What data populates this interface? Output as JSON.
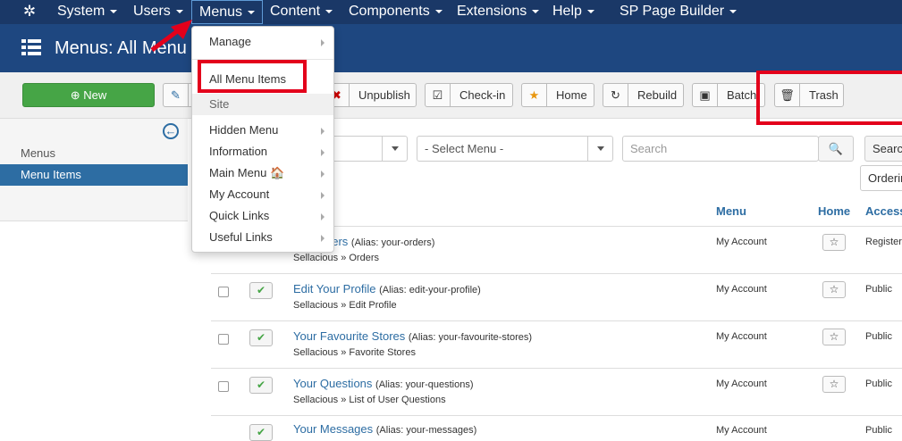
{
  "nav": {
    "items": [
      "System",
      "Users",
      "Menus",
      "Content",
      "Components",
      "Extensions",
      "Help",
      "SP Page Builder"
    ]
  },
  "header": {
    "title": "Menus: All Menu Items"
  },
  "toolbar": {
    "new": "New",
    "unpublish": "Unpublish",
    "checkin": "Check-in",
    "home": "Home",
    "rebuild": "Rebuild",
    "batch": "Batch",
    "trash": "Trash"
  },
  "sidebar": {
    "items": [
      "Menus",
      "Menu Items"
    ]
  },
  "filters": {
    "select_menu": "- Select Menu -",
    "search_placeholder": "Search",
    "search_button": "Search",
    "ordering": "Ordering"
  },
  "table": {
    "headers": {
      "menu": "Menu",
      "home": "Home",
      "access": "Access"
    },
    "rows": [
      {
        "title": "Your Orders",
        "title_visible": "ders",
        "alias": "(Alias: your-orders)",
        "path": "Sellacious » Orders",
        "menu": "My Account",
        "access": "Registered"
      },
      {
        "title": "Edit Your Profile",
        "alias": "(Alias: edit-your-profile)",
        "path": "Sellacious » Edit Profile",
        "menu": "My Account",
        "access": "Public"
      },
      {
        "title": "Your Favourite Stores",
        "alias": "(Alias: your-favourite-stores)",
        "path": "Sellacious » Favorite Stores",
        "menu": "My Account",
        "access": "Public"
      },
      {
        "title": "Your Questions",
        "alias": "(Alias: your-questions)",
        "path": "Sellacious » List of User Questions",
        "menu": "My Account",
        "access": "Public"
      },
      {
        "title": "Your Messages",
        "alias": "(Alias: your-messages)",
        "path": "",
        "menu": "My Account",
        "access": "Public"
      }
    ]
  },
  "dropdown": {
    "manage": "Manage",
    "all_menu_items": "All Menu Items",
    "site": "Site",
    "menus": [
      "Hidden Menu",
      "Information",
      "Main Menu",
      "My Account",
      "Quick Links",
      "Useful Links"
    ]
  },
  "colors": {
    "navbar": "#1a3867",
    "titlebar": "#1e4780",
    "accent": "#2d6da3",
    "highlight": "#e3001b",
    "new_button": "#46a546"
  }
}
